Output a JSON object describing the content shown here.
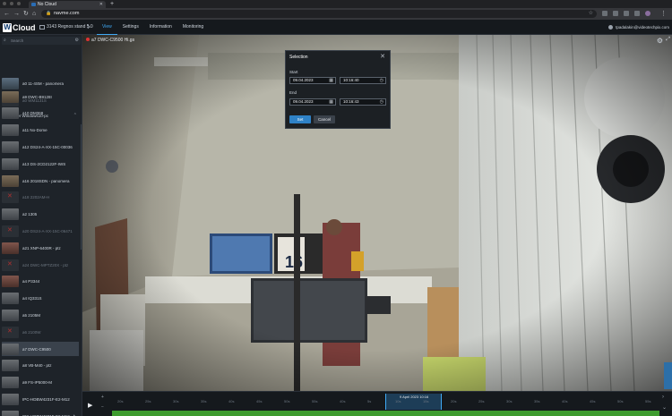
{
  "browser": {
    "tab_title": "No Cloud",
    "url": "navme.com"
  },
  "header": {
    "logo_letter": "W",
    "logo_name": "Cloud",
    "site_name": "3143 Regnos stand 5.0",
    "menu": [
      "View",
      "Settings",
      "Information",
      "Monitoring"
    ],
    "user": "tpadalakin@videotechpix.com"
  },
  "sidebar": {
    "search_placeholder": "Search",
    "group_label": "Server Windows10-pc",
    "cameras_top": [
      {
        "label": "a0 11-4SM - panomera",
        "type": "blue",
        "dim": false
      },
      {
        "label": "a0 WM1131S",
        "type": "off",
        "dim": true
      }
    ],
    "cameras": [
      {
        "label": "a9 DWC-B9128I",
        "type": "warm",
        "dim": false
      },
      {
        "label": "a10 DM368",
        "type": "normal",
        "dim": false
      },
      {
        "label": "a11 No-Dome",
        "type": "normal",
        "dim": false
      },
      {
        "label": "a12 DS24-A-XX-15C-00036",
        "type": "normal",
        "dim": false
      },
      {
        "label": "a13 DS-2CD2122F-IWS",
        "type": "normal",
        "dim": false
      },
      {
        "label": "a16 2018SDN - panomera",
        "type": "warm",
        "dim": false
      },
      {
        "label": "a18 2202AM-H",
        "type": "off",
        "dim": true
      },
      {
        "label": "a2 1305",
        "type": "normal",
        "dim": false
      },
      {
        "label": "a20 DS24-A-XX-15C-06471",
        "type": "off",
        "dim": true
      },
      {
        "label": "a21 XNP-6400R - ptz",
        "type": "red",
        "dim": false
      },
      {
        "label": "a24 DWC-MPTZ20X - ptz",
        "type": "off",
        "dim": true
      },
      {
        "label": "a4 P3344",
        "type": "red",
        "dim": false
      },
      {
        "label": "a4 IQ331S",
        "type": "normal",
        "dim": false
      },
      {
        "label": "a5 2105M",
        "type": "normal",
        "dim": false
      },
      {
        "label": "a6 2100W",
        "type": "off",
        "dim": true
      },
      {
        "label": "a7 DWC-C9500",
        "type": "normal",
        "dim": false,
        "selected": true
      },
      {
        "label": "a8 VB-M40 - ptz",
        "type": "normal",
        "dim": false
      },
      {
        "label": "a9 FS-IP5000-M",
        "type": "normal",
        "dim": false
      },
      {
        "label": "IPC-HDBW4231F-E2-M12",
        "type": "normal",
        "dim": false
      },
      {
        "label": "IPC-HDBW4231F-E2-M12 - h...",
        "type": "normal",
        "dim": false
      }
    ]
  },
  "main": {
    "camera_title": "a7 DWC-C9500 Hi.gs"
  },
  "dialog": {
    "title": "Selection",
    "start_label": "Start",
    "start_date": "09.04.2023",
    "start_time": "10:16:40",
    "end_label": "End",
    "end_date": "09.04.2023",
    "end_time": "10:16:43",
    "set_label": "Set",
    "cancel_label": "Cancel"
  },
  "timeline": {
    "ticks": [
      "20s",
      "25s",
      "30s",
      "35s",
      "40s",
      "45s",
      "50s",
      "55s",
      "40s",
      "5s",
      "10s",
      "15s",
      "20s",
      "25s",
      "30s",
      "35s",
      "40s",
      "45s",
      "50s",
      "55s"
    ],
    "selected_label": "9 April 2023 10:16"
  },
  "colors": {
    "accent": "#3fa9f5",
    "primary_button": "#2f82c7",
    "recording_bar": "#3e9c2f",
    "error": "#b03030"
  }
}
